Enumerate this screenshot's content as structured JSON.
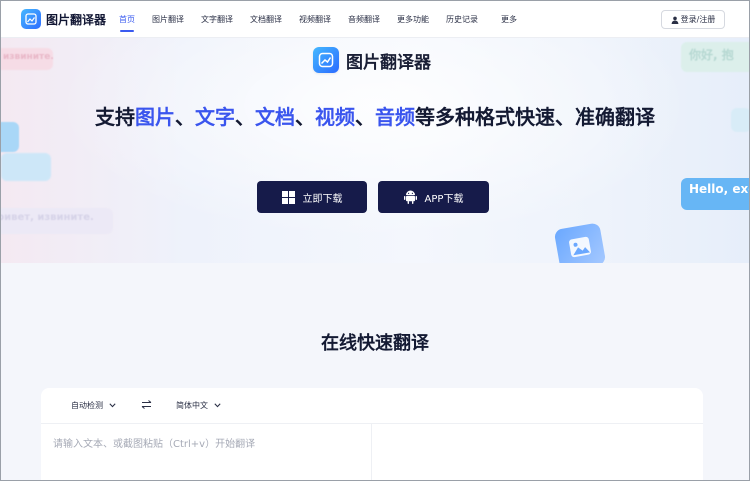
{
  "header": {
    "logo_text": "图片翻译器",
    "logo_icon": "image-translate-icon",
    "nav": [
      "首页",
      "图片翻译",
      "文字翻译",
      "文档翻译",
      "视频翻译",
      "音频翻译",
      "更多功能",
      "历史记录",
      "更多"
    ],
    "active_nav": "首页",
    "login_label": "登录/注册"
  },
  "hero": {
    "brand_name": "图片翻译器",
    "headline_parts": [
      "支持",
      "图片",
      "、",
      "文字",
      "、",
      "文档",
      "、",
      "视频",
      "、",
      "音频",
      "等多种格式快速、准确翻译"
    ],
    "download_label": "立即下载",
    "app_label": "APP下载",
    "bubbles": {
      "left_top": "извините.",
      "left_bottom": "ривет, извините.",
      "right_top": "你好, 抱",
      "right_mid": "Hello, exc"
    }
  },
  "section": {
    "title": "在线快速翻译",
    "source_lang": "自动检测",
    "target_lang": "简体中文",
    "placeholder": "请输入文本、或截图粘贴（Ctrl+v）开始翻译"
  },
  "colors": {
    "accent": "#3a5bf0",
    "button_dark": "#161b4a"
  }
}
